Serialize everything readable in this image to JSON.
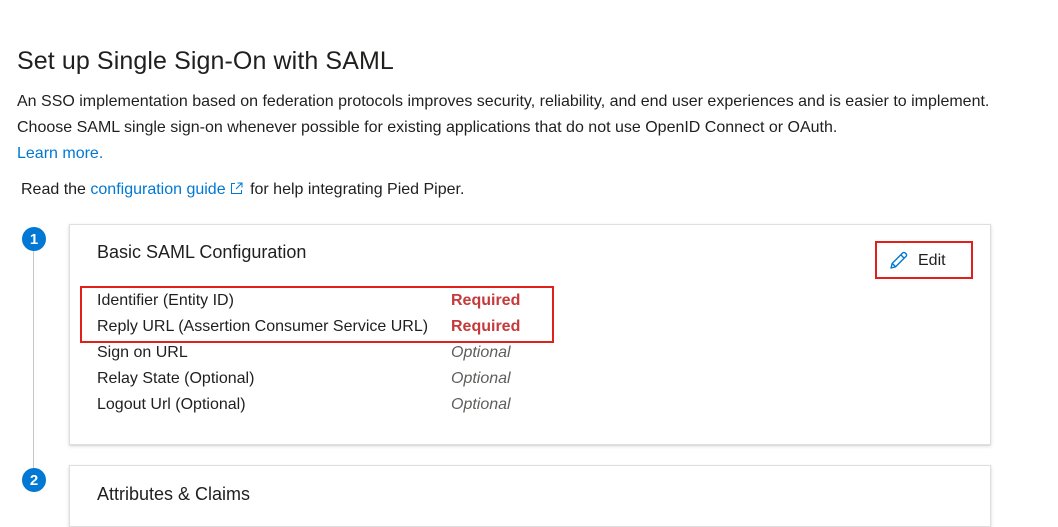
{
  "page": {
    "title": "Set up Single Sign-On with SAML",
    "intro_text": "An SSO implementation based on federation protocols improves security, reliability, and end user experiences and is easier to implement. Choose SAML single sign-on whenever possible for existing applications that do not use OpenID Connect or OAuth.",
    "learn_more": "Learn more.",
    "guide_prefix": "Read the",
    "guide_link": "configuration guide",
    "guide_suffix": "for help integrating Pied Piper."
  },
  "steps": [
    {
      "number": "1",
      "title": "Basic SAML Configuration",
      "edit_label": "Edit",
      "fields": [
        {
          "label": "Identifier (Entity ID)",
          "status": "Required"
        },
        {
          "label": "Reply URL (Assertion Consumer Service URL)",
          "status": "Required"
        },
        {
          "label": "Sign on URL",
          "status": "Optional"
        },
        {
          "label": "Relay State (Optional)",
          "status": "Optional"
        },
        {
          "label": "Logout Url (Optional)",
          "status": "Optional"
        }
      ]
    },
    {
      "number": "2",
      "title": "Attributes & Claims"
    }
  ],
  "icons": {
    "edit": "pencil-icon",
    "external": "external-link-icon"
  },
  "colors": {
    "accent": "#0078d4",
    "required": "#c53a3a",
    "highlight": "#e0201a"
  }
}
